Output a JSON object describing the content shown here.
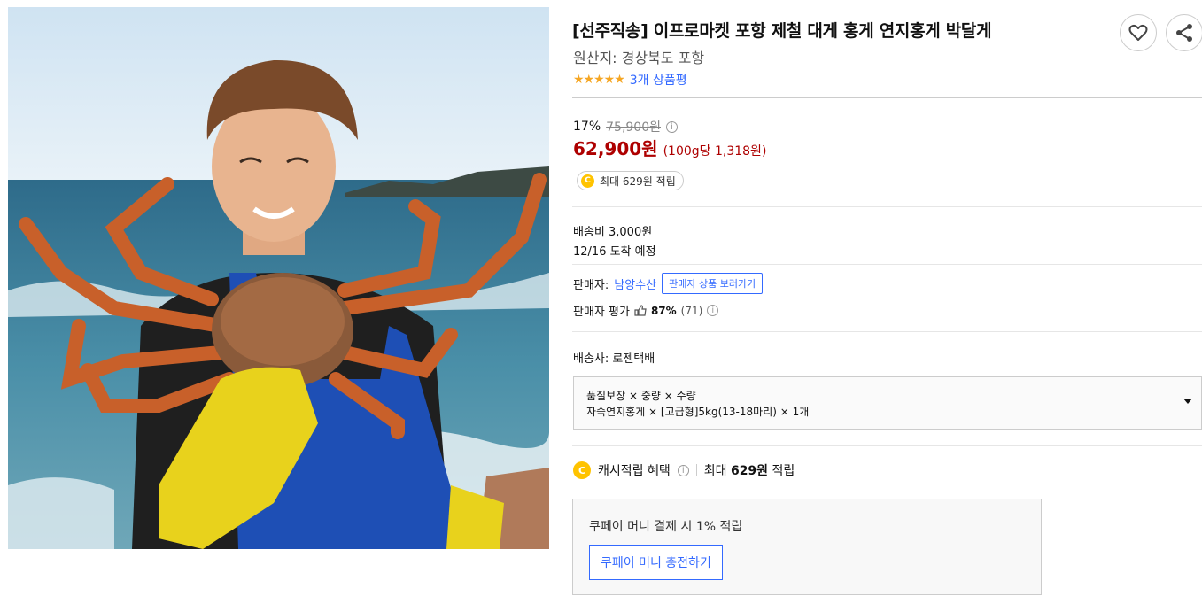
{
  "product": {
    "title": "[선주직송] 이프로마켓 포항 제철 대게 홍게 연지홍게 박달게",
    "origin": "원산지: 경상북도 포항",
    "stars": "★★★★★",
    "review_count": "3개 상품평"
  },
  "icons": {
    "wish": "heart-icon",
    "share": "share-icon"
  },
  "price": {
    "discount_rate": "17%",
    "original": "75,900원",
    "sale": "62,900원",
    "unit": "(100g당 1,318원)",
    "cash_badge": "최대 629원 적립",
    "coin_letter": "C"
  },
  "shipping": {
    "fee": "배송비 3,000원",
    "arrival": "12/16 도착 예정",
    "carrier": "배송사: 로젠택배"
  },
  "seller": {
    "label": "판매자:",
    "name": "남양수산",
    "link": "판매자 상품 보러가기",
    "rating_label": "판매자 평가",
    "rating_pct": "87%",
    "rating_count": "(71)"
  },
  "option": {
    "line1": "품질보장 × 중량 × 수량",
    "line2": "자숙연지홍게 × [고급형]5kg(13-18마리) × 1개"
  },
  "benefit": {
    "label": "캐시적립 혜택",
    "max_prefix": "최대",
    "max_amount": "629원",
    "max_suffix": "적립"
  },
  "coupay": {
    "text": "쿠페이 머니 결제 시 1% 적립",
    "button": "쿠페이 머니 충전하기"
  },
  "colors": {
    "accent_blue": "#346aff",
    "price_red": "#ae0000",
    "star": "#f5a623",
    "coin": "#ffc300"
  }
}
